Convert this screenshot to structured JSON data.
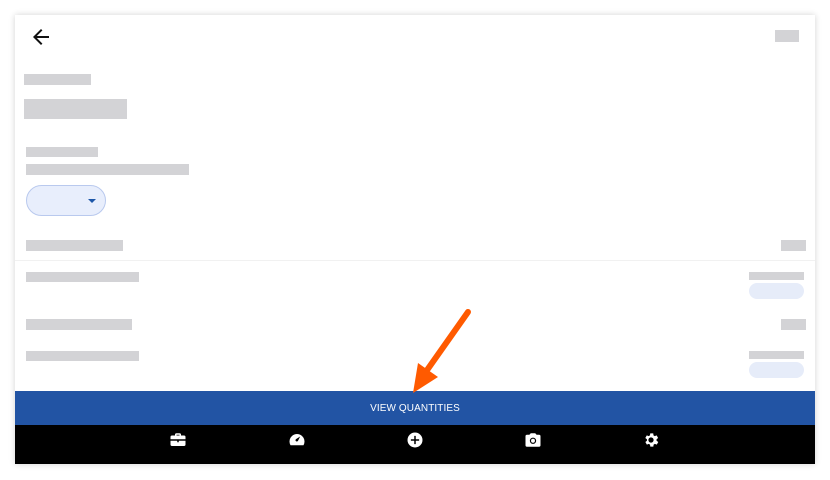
{
  "bottom_button": {
    "label": "VIEW QUANTITIES"
  },
  "bottom_nav": {
    "items": [
      {
        "icon": "briefcase-icon"
      },
      {
        "icon": "speedometer-icon"
      },
      {
        "icon": "add-circle-icon"
      },
      {
        "icon": "camera-icon"
      },
      {
        "icon": "gear-icon"
      }
    ]
  },
  "colors": {
    "primary": "#2254a4",
    "nav_background": "#000000",
    "placeholder": "#d3d3d6",
    "chip_background": "#e8eefc",
    "annotation_arrow": "#ff5a00"
  }
}
